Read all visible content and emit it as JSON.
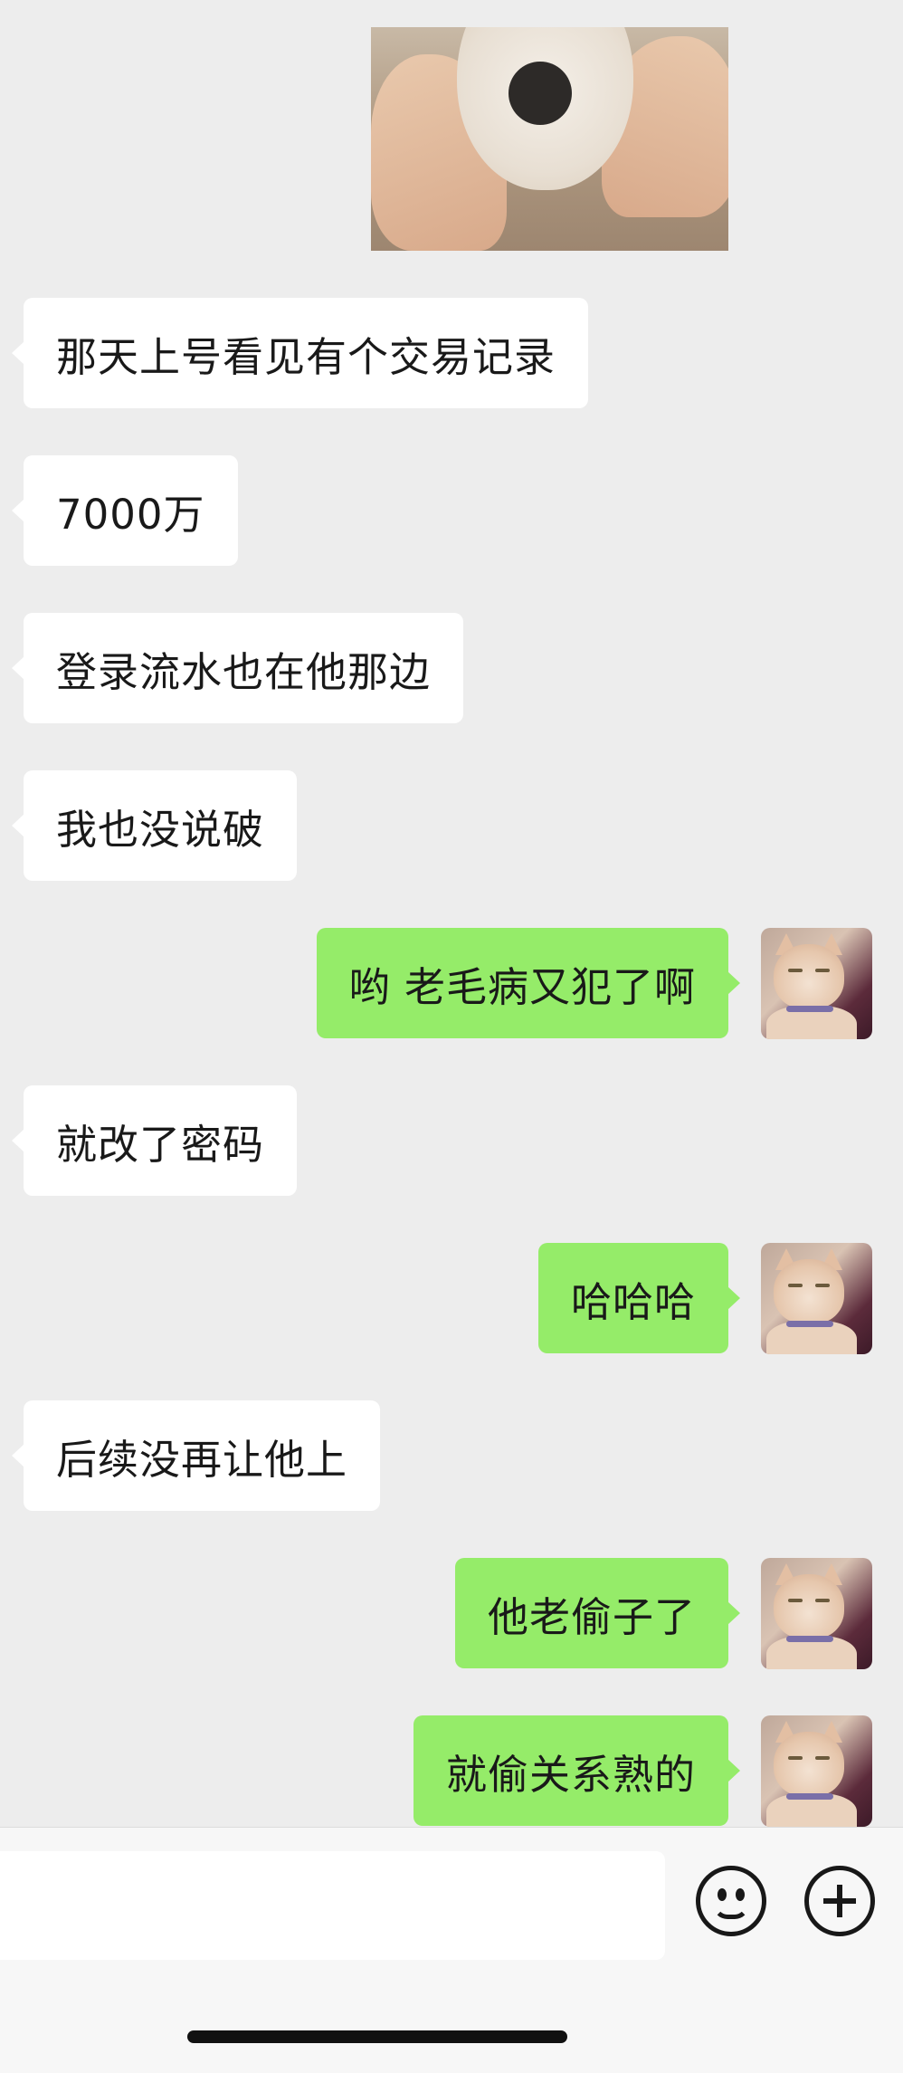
{
  "chat": {
    "messages": [
      {
        "side": "left",
        "text": "那天上号看见有个交易记录"
      },
      {
        "side": "left",
        "text": "7000万"
      },
      {
        "side": "left",
        "text": "登录流水也在他那边"
      },
      {
        "side": "left",
        "text": "我也没说破"
      },
      {
        "side": "right",
        "text": "哟 老毛病又犯了啊"
      },
      {
        "side": "left",
        "text": "就改了密码"
      },
      {
        "side": "right",
        "text": "哈哈哈"
      },
      {
        "side": "left",
        "text": "后续没再让他上"
      },
      {
        "side": "right",
        "text": "他老偷子了"
      },
      {
        "side": "right",
        "text": "就偷关系熟的"
      }
    ]
  },
  "colors": {
    "background": "#ededed",
    "sent_bubble": "#95ec69",
    "received_bubble": "#ffffff"
  },
  "icons": {
    "emoji": "smiley-face-icon",
    "more": "plus-circle-icon"
  },
  "input": {
    "value": ""
  }
}
